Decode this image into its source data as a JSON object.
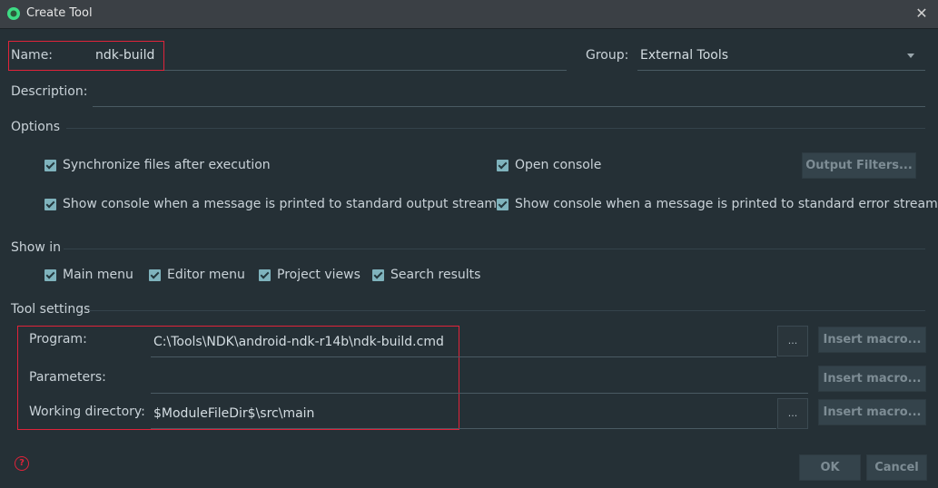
{
  "window": {
    "title": "Create Tool",
    "close_icon": "close-icon"
  },
  "name": {
    "label": "Name:",
    "value": "ndk-build"
  },
  "group": {
    "label": "Group:",
    "value": "External Tools"
  },
  "description": {
    "label": "Description:",
    "value": ""
  },
  "options": {
    "heading": "Options",
    "sync_files": "Synchronize files after execution",
    "open_console": "Open console",
    "output_filters": "Output Filters...",
    "show_console_stdout": "Show console when a message is printed to standard output stream",
    "show_console_stderr": "Show console when a message is printed to standard error stream"
  },
  "show_in": {
    "heading": "Show in",
    "items": [
      "Main menu",
      "Editor menu",
      "Project views",
      "Search results"
    ]
  },
  "tool_settings": {
    "heading": "Tool settings",
    "program_label": "Program:",
    "program_value": "C:\\Tools\\NDK\\android-ndk-r14b\\ndk-build.cmd",
    "parameters_label": "Parameters:",
    "parameters_value": "",
    "working_dir_label": "Working directory:",
    "working_dir_value": "$ModuleFileDir$\\src\\main",
    "browse_label": "...",
    "insert_macro_label": "Insert macro..."
  },
  "footer": {
    "ok": "OK",
    "cancel": "Cancel",
    "help_icon": "help-icon"
  },
  "colors": {
    "background": "#253036",
    "checkbox": "#7fb3bd",
    "highlight": "#e0233a"
  }
}
